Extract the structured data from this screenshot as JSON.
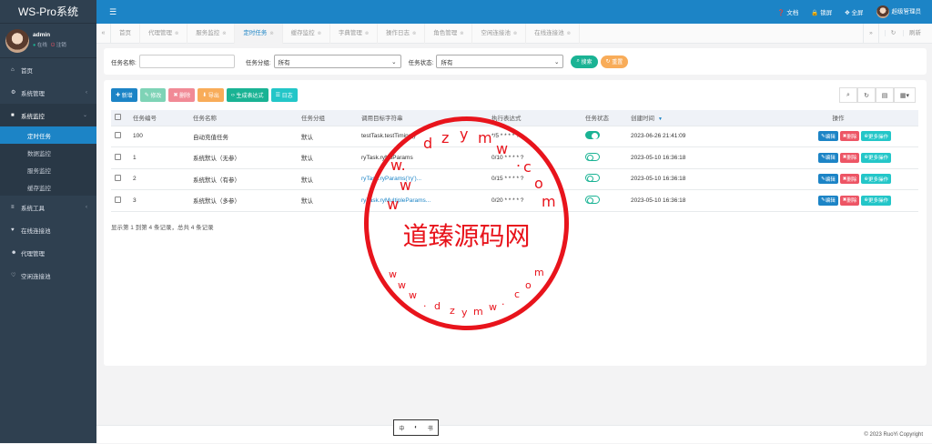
{
  "app": {
    "title": "WS-Pro系统"
  },
  "user": {
    "name": "admin",
    "online": "在线",
    "logout": "注销"
  },
  "topbar": {
    "docs": "文档",
    "lock": "锁屏",
    "fullscreen": "全屏",
    "account": "超级管理员"
  },
  "sidebar": {
    "home": "首页",
    "system_manage": "系统管理",
    "system_monitor": "系统监控",
    "monitor_children": [
      "定时任务",
      "数据监控",
      "服务监控",
      "缓存监控"
    ],
    "system_tools": "系统工具",
    "online_connect": "在线连接池",
    "proxy_manage": "代理管理",
    "idle_connect": "空闲连接池"
  },
  "tabs": [
    "首页",
    "代理管理",
    "服务监控",
    "定时任务",
    "缓存监控",
    "字典管理",
    "操作日志",
    "角色管理",
    "空闲连接池",
    "在线连接池"
  ],
  "tabs_right": {
    "refresh": "刷新"
  },
  "search": {
    "name_label": "任务名称:",
    "group_label": "任务分组:",
    "group_value": "所有",
    "status_label": "任务状态:",
    "status_value": "所有",
    "search_btn": "搜索",
    "reset_btn": "重置"
  },
  "toolbar": {
    "add": "新增",
    "edit": "修改",
    "delete": "删除",
    "export": "导出",
    "generate": "生成表达式",
    "log": "日志"
  },
  "table": {
    "headers": [
      "任务编号",
      "任务名称",
      "任务分组",
      "调用目标字符串",
      "执行表达式",
      "任务状态",
      "创建时间",
      "操作"
    ],
    "rows": [
      {
        "id": "100",
        "name": "自动充值任务",
        "group": "默认",
        "target": "testTask.testTiming()",
        "cron": "*/5 * * * * ?",
        "status": "on",
        "created": "2023-06-26 21:41:09"
      },
      {
        "id": "1",
        "name": "系统默认（无参）",
        "group": "默认",
        "target": "ryTask.ryNoParams",
        "cron": "0/10 * * * * ?",
        "status": "off",
        "created": "2023-05-10 16:36:18"
      },
      {
        "id": "2",
        "name": "系统默认（有参）",
        "group": "默认",
        "target": "ryTask.ryParams('ry')...",
        "cron": "0/15 * * * * ?",
        "status": "off",
        "created": "2023-05-10 16:36:18"
      },
      {
        "id": "3",
        "name": "系统默认（多参）",
        "group": "默认",
        "target": "ryTask.ryMultipleParams...",
        "cron": "0/20 * * * * ?",
        "status": "off",
        "created": "2023-05-10 16:36:18"
      }
    ],
    "ops": {
      "edit": "编辑",
      "delete": "删除",
      "more": "更多操作"
    },
    "pagination": "显示第 1 到第 4 条记录，总共 4 条记录"
  },
  "footer": {
    "copyright": "© 2023 RuoYi Copyright"
  },
  "watermark": {
    "text": "道臻源码网",
    "url": "www.dzym.com",
    "color": "#e8141c"
  },
  "colors": {
    "primary": "#1c84c6",
    "success": "#1ab394",
    "danger": "#ed5565",
    "warning": "#f8ac59",
    "sidebar": "#2f4050"
  }
}
